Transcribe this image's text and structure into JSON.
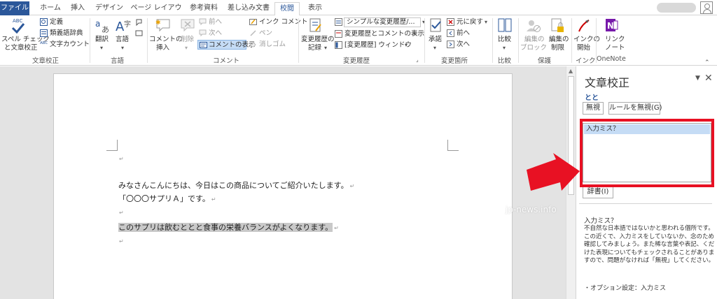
{
  "tabs": [
    {
      "label": "ファイル"
    },
    {
      "label": "ホーム"
    },
    {
      "label": "挿入"
    },
    {
      "label": "デザイン"
    },
    {
      "label": "ページ レイアウト"
    },
    {
      "label": "参考資料"
    },
    {
      "label": "差し込み文書"
    },
    {
      "label": "校閲"
    },
    {
      "label": "表示"
    }
  ],
  "ribbon": {
    "proofing": {
      "spelling_top": "ABC",
      "spelling_label": "スペル チェック",
      "spelling_label2": "と文章校正",
      "define": "定義",
      "thesaurus": "類義語辞典",
      "word_count": "文字カウント",
      "word_count_badge": "ABC",
      "group": "文章校正"
    },
    "language": {
      "translate": "翻訳",
      "language": "言語",
      "group": "言語"
    },
    "comment": {
      "new_comment": "コメントの",
      "new_comment2": "挿入",
      "delete": "削除",
      "previous": "前へ",
      "next": "次へ",
      "show_comments": "コメントの表示",
      "ink_comment": "インク コメント",
      "pen": "ペン",
      "eraser": "消しゴム",
      "group": "コメント"
    },
    "tracking": {
      "track_changes": "変更履歴の",
      "track_changes2": "記録",
      "markup_combo": "シンプルな変更履歴/...",
      "show_markup": "変更履歴とコメントの表示",
      "reviewing_pane": "[変更履歴] ウィンドウ",
      "group": "変更履歴"
    },
    "changes": {
      "accept": "承諾",
      "reject": "元に戻す",
      "previous": "前へ",
      "next": "次へ",
      "group": "変更箇所"
    },
    "compare": {
      "compare": "比較",
      "group": "比較"
    },
    "protect": {
      "block_authors": "編集の",
      "block_authors2": "ブロック",
      "restrict": "編集の",
      "restrict2": "制限",
      "group": "保護"
    },
    "ink": {
      "start_inking": "インクの",
      "start_inking2": "開始",
      "group": "インク"
    },
    "onenote": {
      "linked_notes": "リンク",
      "linked_notes2": "ノート",
      "group": "OneNote"
    }
  },
  "document": {
    "line1": "みなさんこんにちは、今日はこの商品についてご紹介いたします。",
    "line2": "「〇〇〇サプリＡ」です。",
    "line3": "このサプリは飲むととと食事の栄養バランスがよくなります。",
    "para_mark": "↵",
    "watermark": "jp-news.info"
  },
  "pane": {
    "title": "文章校正",
    "word": "とと",
    "ignore": "無視",
    "ignore_rule": "ルールを無視(G)",
    "suggestion": "入力ミス？",
    "dictionary": "辞書(I)",
    "info_title": "入力ミス？",
    "info_body": "不自然な日本語ではないかと思われる個所です。この近くで、入力ミスをしていないか、念のため確認してみましょう。また稀な言葉や表記、くだけた表現についてもチェックされることがありますので、問題がなければ「無視」してください。",
    "option": "・オプション設定：入力ミス"
  },
  "colors": {
    "accent": "#2b579a",
    "highlight_box": "#e81123",
    "arrow": "#e81123"
  }
}
